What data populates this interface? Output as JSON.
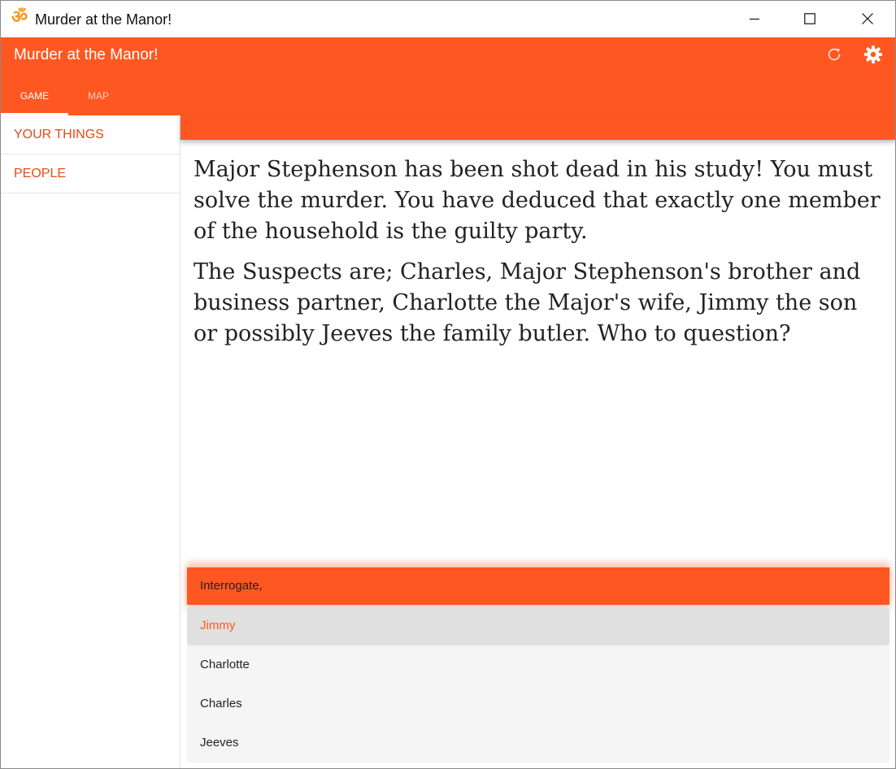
{
  "window": {
    "title": "Murder at the Manor!",
    "app_icon": "om-icon",
    "controls": [
      "minimize-icon",
      "maximize-icon",
      "close-icon"
    ]
  },
  "appbar": {
    "title": "Murder at the Manor!",
    "actions": [
      "refresh-icon",
      "gear-icon"
    ],
    "tabs": [
      {
        "label": "GAME",
        "active": true
      },
      {
        "label": "MAP",
        "active": false
      }
    ]
  },
  "sidebar": {
    "items": [
      {
        "label": "YOUR THINGS"
      },
      {
        "label": "PEOPLE"
      }
    ]
  },
  "story": {
    "paragraphs": [
      "Major Stephenson has been shot dead in his study! You must solve the murder. You have deduced that exactly one member of the household is the guilty party.",
      "The Suspects are; Charles, Major Stephenson's brother and business partner, Charlotte the Major's wife, Jimmy the son or possibly Jeeves the family butler. Who to question?"
    ]
  },
  "choices": {
    "prompt": "Interrogate,",
    "options": [
      {
        "label": "Jimmy",
        "selected": true
      },
      {
        "label": "Charlotte",
        "selected": false
      },
      {
        "label": "Charles",
        "selected": false
      },
      {
        "label": "Jeeves",
        "selected": false
      }
    ]
  },
  "colors": {
    "accent": "#ff5722",
    "accent_text": "#e64a19",
    "selected_bg": "#e0e0e0",
    "list_bg": "#f5f5f5",
    "app_icon": "#f39a1e"
  }
}
